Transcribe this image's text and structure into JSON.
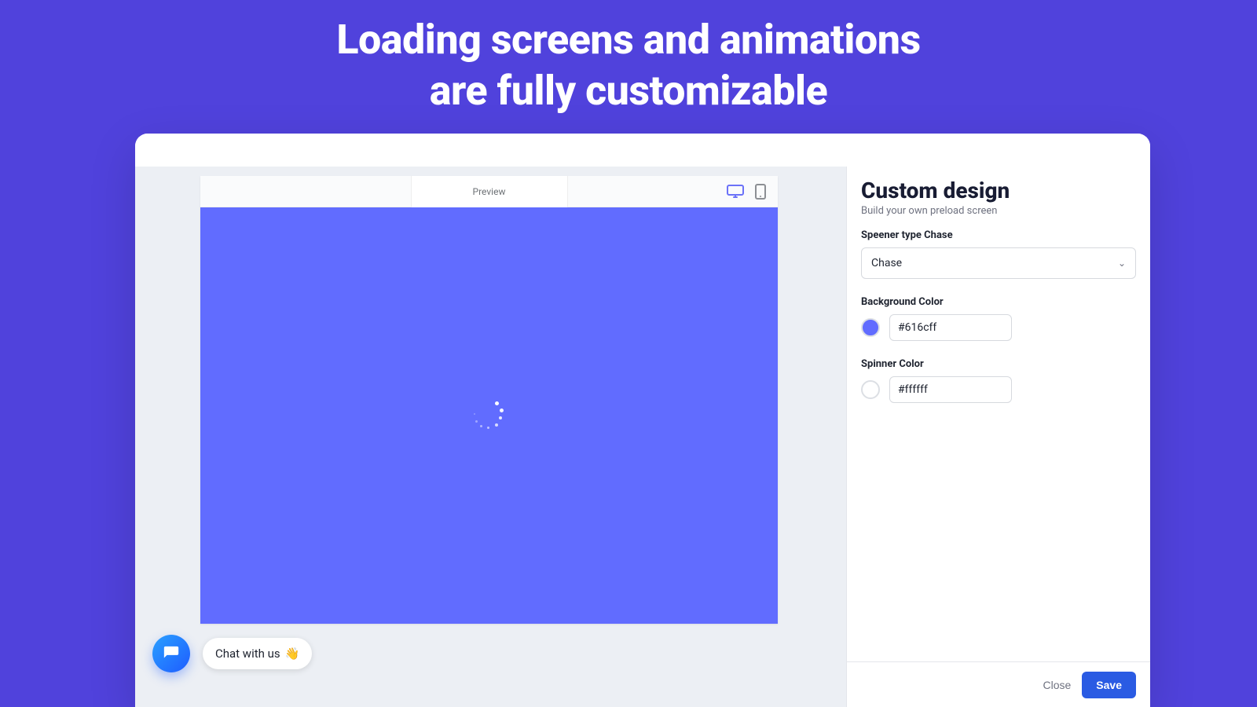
{
  "hero": {
    "line1": "Loading screens and animations",
    "line2": "are fully customizable"
  },
  "preview": {
    "tab_label": "Preview",
    "canvas_bg": "#616cff",
    "spinner_color": "#ffffff"
  },
  "chat": {
    "pill_text": "Chat with us",
    "emoji": "👋"
  },
  "panel": {
    "title": "Custom design",
    "subtitle": "Build your own preload screen",
    "spinner_type_label": "Speener type Chase",
    "spinner_type_value": "Chase",
    "bg_color_label": "Background Color",
    "bg_color_value": "#616cff",
    "spinner_color_label": "Spinner Color",
    "spinner_color_value": "#ffffff",
    "close_label": "Close",
    "save_label": "Save"
  },
  "icons": {
    "desktop": "desktop-icon",
    "mobile": "mobile-icon",
    "chat": "chat-icon"
  }
}
